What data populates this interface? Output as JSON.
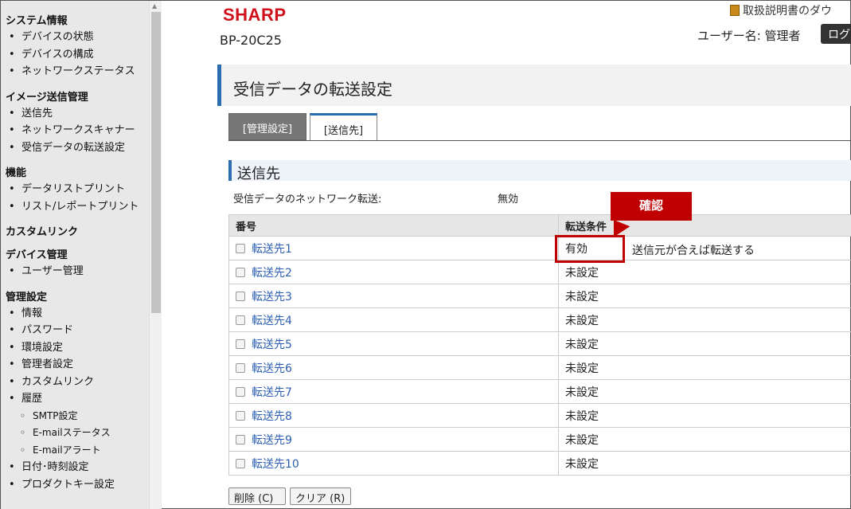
{
  "sidebar": {
    "sections": [
      {
        "title": "システム情報",
        "items": [
          "デバイスの状態",
          "デバイスの構成",
          "ネットワークステータス"
        ]
      },
      {
        "title": "イメージ送信管理",
        "items": [
          "送信先",
          "ネットワークスキャナー",
          "受信データの転送設定"
        ]
      },
      {
        "title": "機能",
        "items": [
          "データリストプリント",
          "リスト/レポートプリント"
        ]
      },
      {
        "title": "カスタムリンク",
        "items": []
      },
      {
        "title": "デバイス管理",
        "items": [
          "ユーザー管理"
        ]
      },
      {
        "title": "管理設定",
        "items": [
          "情報",
          "パスワード",
          "環境設定",
          "管理者設定",
          "カスタムリンク",
          "履歴"
        ]
      }
    ],
    "history_subitems": [
      "SMTP設定",
      "E-mailステータス",
      "E-mailアラート"
    ],
    "trailing_items": [
      "日付･時刻設定",
      "プロダクトキー設定"
    ]
  },
  "header": {
    "logo": "SHARP",
    "model": "BP-20C25",
    "manual_link": "取扱説明書のダウ",
    "user_label": "ユーザー名: 管理者",
    "logout_label": "ログ"
  },
  "page_title": "受信データの転送設定",
  "tabs": {
    "admin": "[管理設定]",
    "destination": "[送信先]"
  },
  "section_title": "送信先",
  "network_transfer": {
    "label": "受信データのネットワーク転送:",
    "value": "無効"
  },
  "table": {
    "headers": [
      "番号",
      "転送条件"
    ],
    "rows": [
      {
        "name": "転送先1",
        "status": "有効",
        "note": "送信元が合えば転送する"
      },
      {
        "name": "転送先2",
        "status": "未設定"
      },
      {
        "name": "転送先3",
        "status": "未設定"
      },
      {
        "name": "転送先4",
        "status": "未設定"
      },
      {
        "name": "転送先5",
        "status": "未設定"
      },
      {
        "name": "転送先6",
        "status": "未設定"
      },
      {
        "name": "転送先7",
        "status": "未設定"
      },
      {
        "name": "転送先8",
        "status": "未設定"
      },
      {
        "name": "転送先9",
        "status": "未設定"
      },
      {
        "name": "転送先10",
        "status": "未設定"
      }
    ]
  },
  "annotation": {
    "callout": "確認"
  },
  "buttons": {
    "delete": "削除 (C)",
    "clear": "クリア (R)"
  },
  "colors": {
    "brand": "#d0101a",
    "accent": "#2a6db0",
    "annotation": "#c00000"
  }
}
